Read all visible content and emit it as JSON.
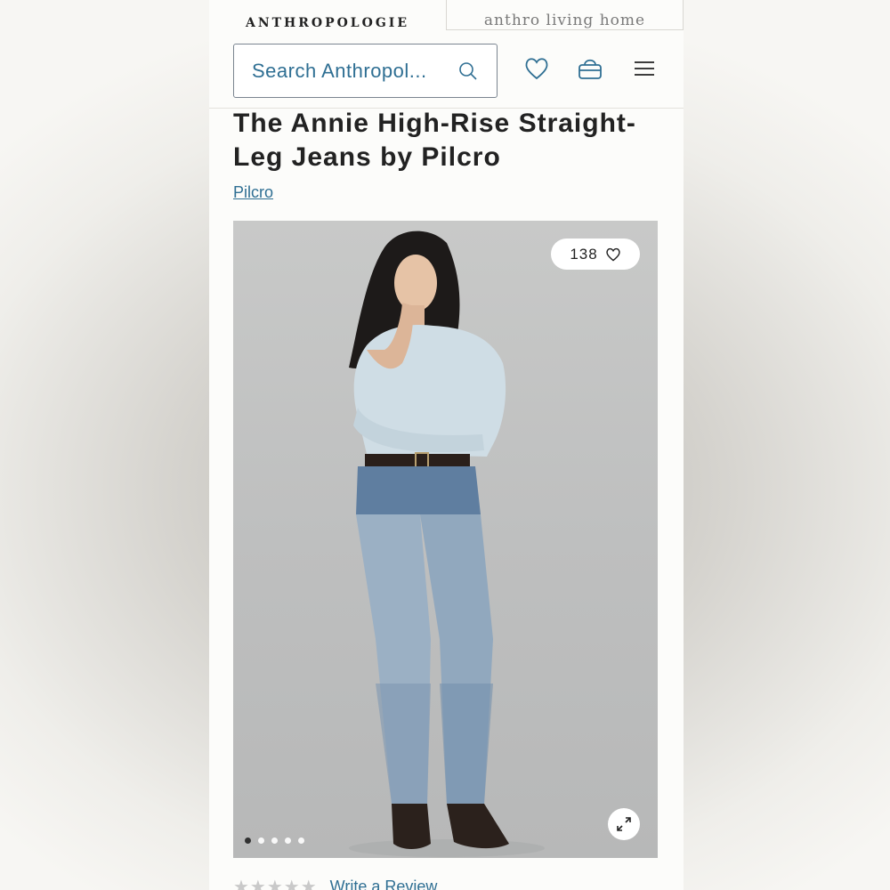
{
  "brand_tabs": {
    "left": "ANTHROPOLOGIE",
    "right": "anthro living home"
  },
  "header": {
    "search_placeholder": "Search Anthropol...",
    "icons": [
      "search-icon",
      "heart-icon",
      "bag-icon",
      "menu-icon"
    ]
  },
  "product": {
    "title": "The Annie High-Rise Straight-Leg Jeans by Pilcro",
    "brand": "Pilcro",
    "favorites_count": "138",
    "image_dots": 5,
    "active_dot": 0
  },
  "reviews": {
    "stars": "★★★★★",
    "link": "Write a Review"
  },
  "colors": {
    "accent": "#2f6f93",
    "text": "#222222",
    "page_bg": "#fcfcfa"
  }
}
